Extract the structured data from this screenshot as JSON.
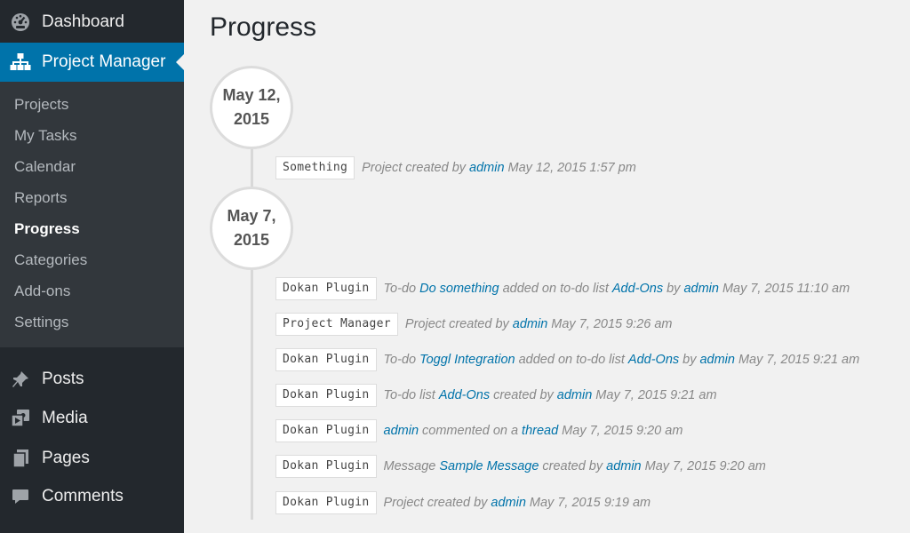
{
  "sidebar": {
    "dashboard": {
      "label": "Dashboard",
      "icon": "dashboard-gauge-icon"
    },
    "project_manager": {
      "label": "Project Manager",
      "icon": "sitemap-icon"
    },
    "submenu": [
      {
        "label": "Projects"
      },
      {
        "label": "My Tasks"
      },
      {
        "label": "Calendar"
      },
      {
        "label": "Reports"
      },
      {
        "label": "Progress",
        "current": true
      },
      {
        "label": "Categories"
      },
      {
        "label": "Add-ons"
      },
      {
        "label": "Settings"
      }
    ],
    "posts": {
      "label": "Posts",
      "icon": "pushpin-icon"
    },
    "media": {
      "label": "Media",
      "icon": "media-icon"
    },
    "pages": {
      "label": "Pages",
      "icon": "pages-icon"
    },
    "comments": {
      "label": "Comments",
      "icon": "comment-bubble-icon"
    }
  },
  "main": {
    "title": "Progress",
    "groups": [
      {
        "date_line1": "May 12,",
        "date_line2": "2015",
        "activities": [
          {
            "project": "Something",
            "parts": [
              {
                "t": "Project created by"
              },
              {
                "t": "admin",
                "link": true
              },
              {
                "t": "May 12, 2015 1:57 pm"
              }
            ]
          }
        ]
      },
      {
        "date_line1": "May 7,",
        "date_line2": "2015",
        "activities": [
          {
            "project": "Dokan Plugin",
            "parts": [
              {
                "t": "To-do"
              },
              {
                "t": "Do something",
                "link": true
              },
              {
                "t": "added on to-do list"
              },
              {
                "t": "Add-Ons",
                "link": true
              },
              {
                "t": "by"
              },
              {
                "t": "admin",
                "link": true
              },
              {
                "t": "May 7, 2015 11:10 am"
              }
            ]
          },
          {
            "project": "Project Manager",
            "parts": [
              {
                "t": "Project created by"
              },
              {
                "t": "admin",
                "link": true
              },
              {
                "t": "May 7, 2015 9:26 am"
              }
            ]
          },
          {
            "project": "Dokan Plugin",
            "parts": [
              {
                "t": "To-do"
              },
              {
                "t": "Toggl Integration",
                "link": true
              },
              {
                "t": "added on to-do list"
              },
              {
                "t": "Add-Ons",
                "link": true
              },
              {
                "t": "by"
              },
              {
                "t": "admin",
                "link": true
              },
              {
                "t": "May 7, 2015 9:21 am"
              }
            ]
          },
          {
            "project": "Dokan Plugin",
            "parts": [
              {
                "t": "To-do list"
              },
              {
                "t": "Add-Ons",
                "link": true
              },
              {
                "t": "created by"
              },
              {
                "t": "admin",
                "link": true
              },
              {
                "t": "May 7, 2015 9:21 am"
              }
            ]
          },
          {
            "project": "Dokan Plugin",
            "parts": [
              {
                "t": "admin",
                "link": true
              },
              {
                "t": "commented on a"
              },
              {
                "t": "thread",
                "link": true
              },
              {
                "t": "May 7, 2015 9:20 am"
              }
            ]
          },
          {
            "project": "Dokan Plugin",
            "parts": [
              {
                "t": "Message"
              },
              {
                "t": "Sample Message",
                "link": true
              },
              {
                "t": "created by"
              },
              {
                "t": "admin",
                "link": true
              },
              {
                "t": "May 7, 2015 9:20 am"
              }
            ]
          },
          {
            "project": "Dokan Plugin",
            "parts": [
              {
                "t": "Project created by"
              },
              {
                "t": "admin",
                "link": true
              },
              {
                "t": "May 7, 2015 9:19 am"
              }
            ]
          }
        ]
      }
    ]
  },
  "colors": {
    "sidebar_bg": "#23282d",
    "submenu_bg": "#32373c",
    "accent": "#0073aa",
    "page_bg": "#f1f1f1"
  }
}
